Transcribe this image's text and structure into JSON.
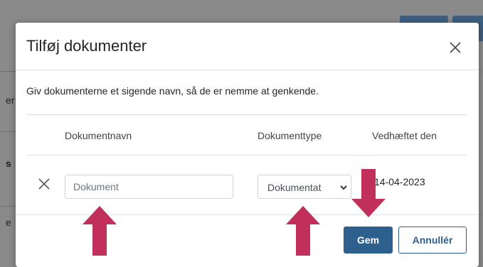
{
  "background": {
    "fragments": [
      "er",
      "s",
      "e"
    ]
  },
  "modal": {
    "title": "Tilføj dokumenter",
    "close_icon": "close-icon",
    "intro": "Giv dokumenterne et sigende navn, så de er nemme at genkende.",
    "table": {
      "headers": [
        "Dokumentnavn",
        "Dokumenttype",
        "Vedhæftet den"
      ],
      "rows": [
        {
          "name_placeholder": "Dokument",
          "type_selected": "Dokumentat",
          "date": "14-04-2023"
        }
      ]
    },
    "footer": {
      "save_label": "Gem",
      "cancel_label": "Annullér"
    }
  },
  "colors": {
    "primary": "#2d5f8f",
    "annotation_arrow": "#c0305a"
  }
}
